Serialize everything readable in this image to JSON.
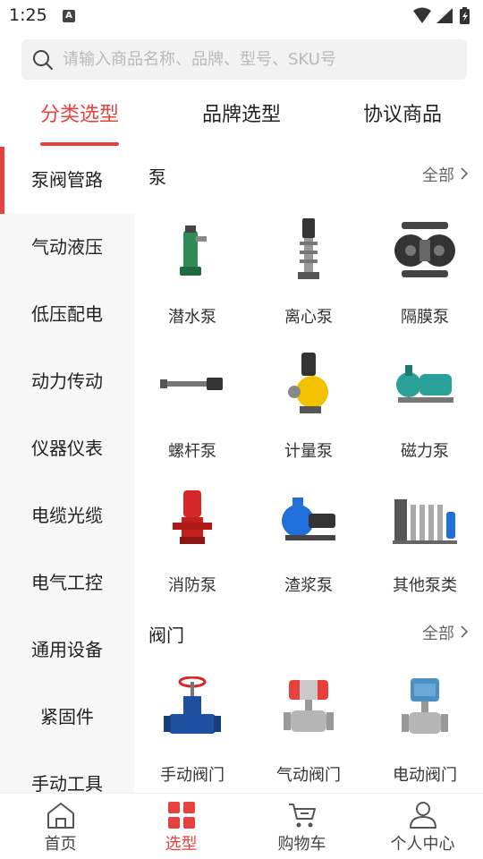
{
  "status_bar": {
    "time": "1:25",
    "notif_letter": "A"
  },
  "search": {
    "placeholder": "请输入商品名称、品牌、型号、SKU号"
  },
  "tabs": [
    {
      "label": "分类选型",
      "active": true
    },
    {
      "label": "品牌选型",
      "active": false
    },
    {
      "label": "协议商品",
      "active": false
    }
  ],
  "sidebar": {
    "items": [
      {
        "label": "泵阀管路",
        "active": true
      },
      {
        "label": "气动液压"
      },
      {
        "label": "低压配电"
      },
      {
        "label": "动力传动"
      },
      {
        "label": "仪器仪表"
      },
      {
        "label": "电缆光缆"
      },
      {
        "label": "电气工控"
      },
      {
        "label": "通用设备"
      },
      {
        "label": "紧固件"
      },
      {
        "label": "手动工具"
      }
    ]
  },
  "sections": [
    {
      "title": "泵",
      "all_label": "全部",
      "products": [
        {
          "name": "潜水泵",
          "icon": "submersible-pump",
          "color": "#2e8b57"
        },
        {
          "name": "离心泵",
          "icon": "centrifugal-pump",
          "color": "#555555"
        },
        {
          "name": "隔膜泵",
          "icon": "diaphragm-pump",
          "color": "#333333"
        },
        {
          "name": "螺杆泵",
          "icon": "screw-pump",
          "color": "#666666"
        },
        {
          "name": "计量泵",
          "icon": "metering-pump",
          "color": "#f2c200"
        },
        {
          "name": "磁力泵",
          "icon": "magnetic-pump",
          "color": "#2aa198"
        },
        {
          "name": "消防泵",
          "icon": "fire-pump",
          "color": "#d62828"
        },
        {
          "name": "渣浆泵",
          "icon": "slurry-pump",
          "color": "#1e6fd9"
        },
        {
          "name": "其他泵类",
          "icon": "other-pumps",
          "color": "#888888"
        }
      ]
    },
    {
      "title": "阀门",
      "all_label": "全部",
      "products": [
        {
          "name": "手动阀门",
          "icon": "manual-valve",
          "color": "#1f4fa0"
        },
        {
          "name": "气动阀门",
          "icon": "pneumatic-valve",
          "color": "#e8413d"
        },
        {
          "name": "电动阀门",
          "icon": "electric-valve",
          "color": "#4a90c2"
        }
      ]
    }
  ],
  "bottom_nav": [
    {
      "label": "首页",
      "icon": "home-icon",
      "active": false
    },
    {
      "label": "选型",
      "icon": "grid-icon",
      "active": true
    },
    {
      "label": "购物车",
      "icon": "cart-icon",
      "active": false
    },
    {
      "label": "个人中心",
      "icon": "person-icon",
      "active": false
    }
  ],
  "colors": {
    "accent": "#e8413d",
    "sidebar_bg": "#f7f7f7"
  }
}
